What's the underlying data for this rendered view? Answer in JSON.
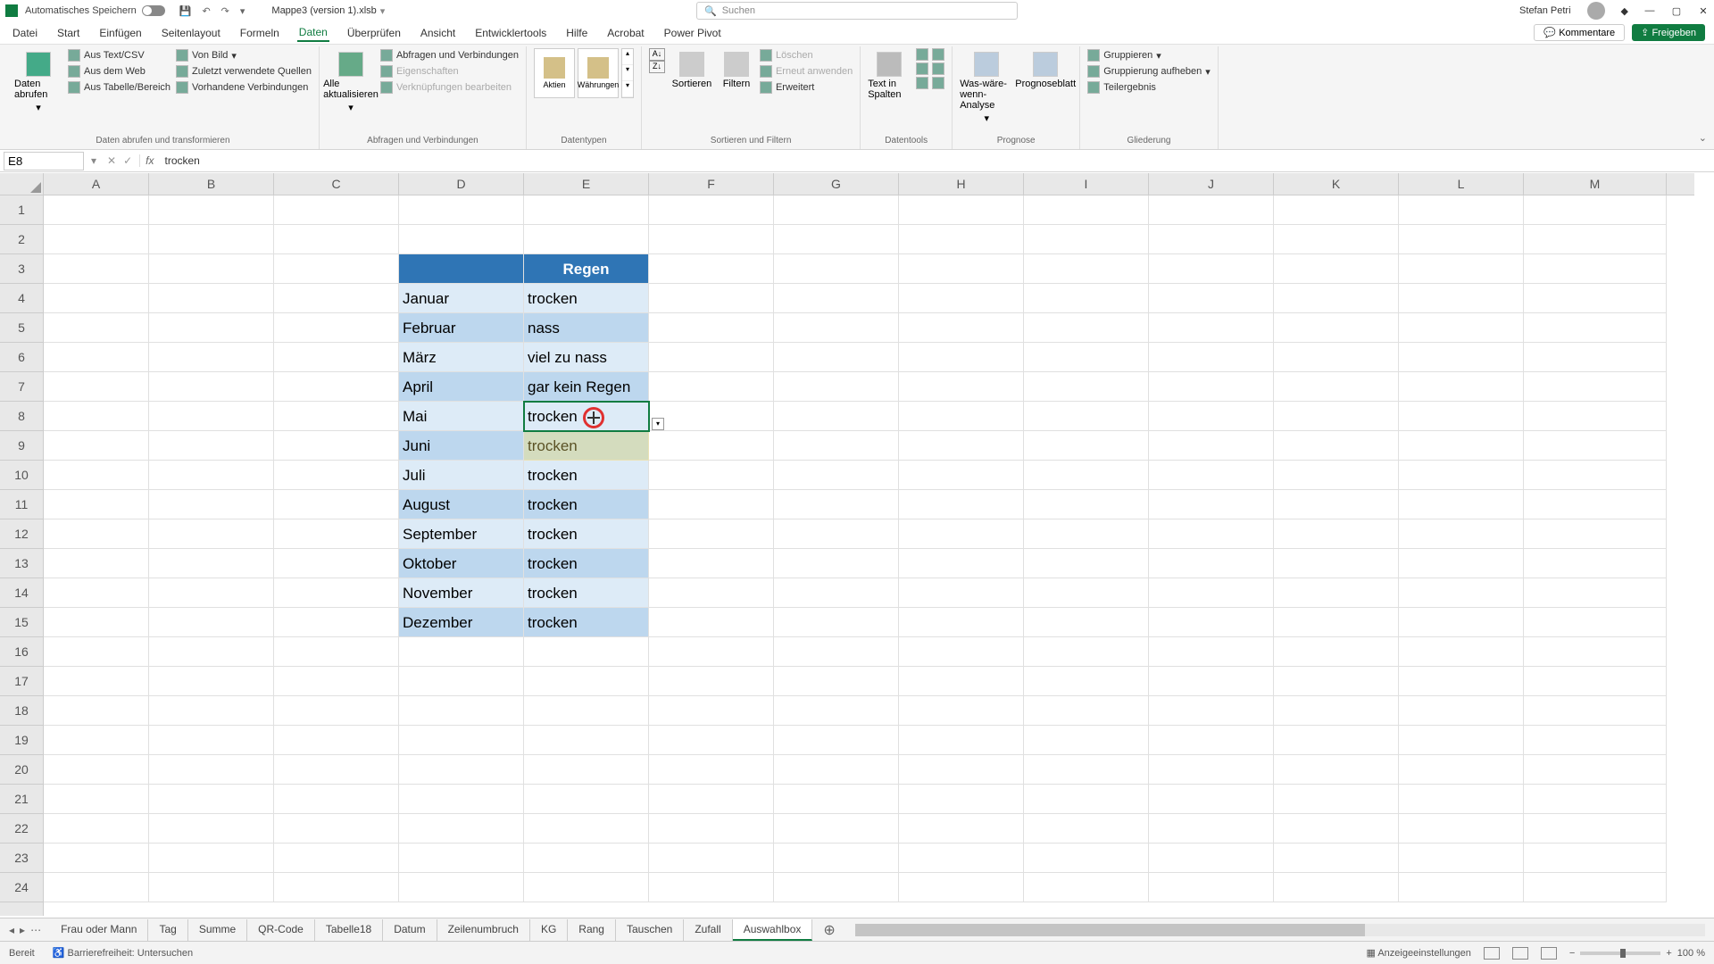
{
  "title": {
    "autosave": "Automatisches Speichern",
    "filename": "Mappe3 (version 1).xlsb",
    "search_placeholder": "Suchen",
    "user": "Stefan Petri"
  },
  "tabs": {
    "items": [
      "Datei",
      "Start",
      "Einfügen",
      "Seitenlayout",
      "Formeln",
      "Daten",
      "Überprüfen",
      "Ansicht",
      "Entwicklertools",
      "Hilfe",
      "Acrobat",
      "Power Pivot"
    ],
    "active": "Daten",
    "comments": "Kommentare",
    "share": "Freigeben"
  },
  "ribbon": {
    "g1": {
      "big": "Daten abrufen",
      "items": [
        "Aus Text/CSV",
        "Aus dem Web",
        "Aus Tabelle/Bereich",
        "Von Bild",
        "Zuletzt verwendete Quellen",
        "Vorhandene Verbindungen"
      ],
      "label": "Daten abrufen und transformieren"
    },
    "g2": {
      "big": "Alle aktualisieren",
      "items": [
        "Abfragen und Verbindungen",
        "Eigenschaften",
        "Verknüpfungen bearbeiten"
      ],
      "label": "Abfragen und Verbindungen"
    },
    "g3": {
      "items": [
        "Aktien",
        "Währungen"
      ],
      "label": "Datentypen"
    },
    "g4": {
      "sort": "Sortieren",
      "filter": "Filtern",
      "items": [
        "Löschen",
        "Erneut anwenden",
        "Erweitert"
      ],
      "label": "Sortieren und Filtern"
    },
    "g5": {
      "big": "Text in Spalten",
      "label": "Datentools"
    },
    "g6": {
      "items": [
        "Was-wäre-wenn-Analyse",
        "Prognoseblatt"
      ],
      "label": "Prognose"
    },
    "g7": {
      "items": [
        "Gruppieren",
        "Gruppierung aufheben",
        "Teilergebnis"
      ],
      "label": "Gliederung"
    }
  },
  "formula": {
    "namebox": "E8",
    "value": "trocken"
  },
  "grid": {
    "cols": [
      "A",
      "B",
      "C",
      "D",
      "E",
      "F",
      "G",
      "H",
      "I",
      "J",
      "K",
      "L",
      "M"
    ],
    "rows": 24,
    "header": {
      "e": "Regen"
    },
    "data": [
      {
        "d": "Januar",
        "e": "trocken"
      },
      {
        "d": "Februar",
        "e": "nass"
      },
      {
        "d": "März",
        "e": "viel zu nass"
      },
      {
        "d": "April",
        "e": "gar kein Regen"
      },
      {
        "d": "Mai",
        "e": "trocken"
      },
      {
        "d": "Juni",
        "e": "trocken"
      },
      {
        "d": "Juli",
        "e": "trocken"
      },
      {
        "d": "August",
        "e": "trocken"
      },
      {
        "d": "September",
        "e": "trocken"
      },
      {
        "d": "Oktober",
        "e": "trocken"
      },
      {
        "d": "November",
        "e": "trocken"
      },
      {
        "d": "Dezember",
        "e": "trocken"
      }
    ]
  },
  "sheets": {
    "tabs": [
      "Frau oder Mann",
      "Tag",
      "Summe",
      "QR-Code",
      "Tabelle18",
      "Datum",
      "Zeilenumbruch",
      "KG",
      "Rang",
      "Tauschen",
      "Zufall",
      "Auswahlbox"
    ],
    "active": "Auswahlbox"
  },
  "status": {
    "ready": "Bereit",
    "acc": "Barrierefreiheit: Untersuchen",
    "display": "Anzeigeeinstellungen",
    "zoom": "100 %"
  }
}
